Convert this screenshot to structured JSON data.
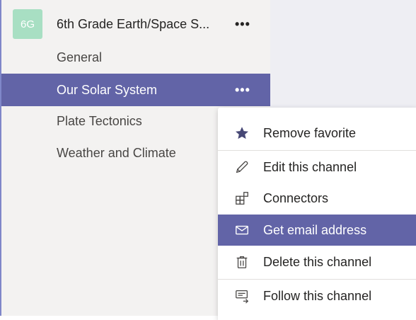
{
  "team": {
    "initials": "6G",
    "name": "6th Grade Earth/Space S...",
    "more": "•••"
  },
  "channels": [
    {
      "label": "General"
    },
    {
      "label": "Our Solar System",
      "more": "•••"
    },
    {
      "label": "Plate Tectonics"
    },
    {
      "label": "Weather and Climate"
    }
  ],
  "context_menu": {
    "items": [
      {
        "label": "Remove favorite",
        "icon": "star-icon"
      },
      {
        "label": "Edit this channel",
        "icon": "pencil-icon"
      },
      {
        "label": "Connectors",
        "icon": "connectors-icon"
      },
      {
        "label": "Get email address",
        "icon": "envelope-icon"
      },
      {
        "label": "Delete this channel",
        "icon": "trash-icon"
      },
      {
        "label": "Follow this channel",
        "icon": "follow-icon"
      }
    ]
  },
  "colors": {
    "accent": "#6264a7",
    "avatar": "#a8dfc3"
  }
}
